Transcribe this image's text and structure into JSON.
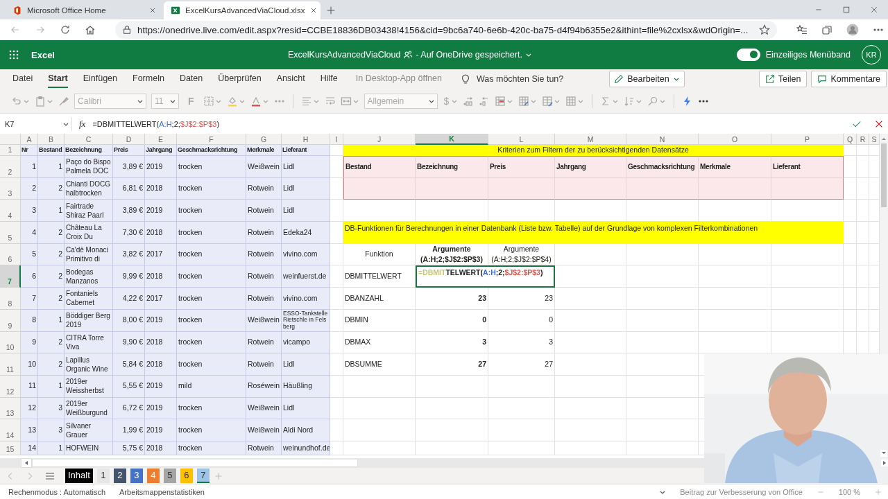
{
  "browser": {
    "tabs": [
      {
        "title": "Microsoft Office Home",
        "selected": false
      },
      {
        "title": "ExcelKursAdvancedViaCloud.xlsx",
        "selected": true
      }
    ],
    "url": "https://onedrive.live.com/edit.aspx?resid=CCBE18836DB03438!4156&cid=9bc6a740-6e6b-420c-ba75-d4f94b6355e2&ithint=file%2cxlsx&wdOrigin=..."
  },
  "app": {
    "name": "Excel",
    "document": "ExcelKursAdvancedViaCloud",
    "save_status": "- Auf OneDrive gespeichert.",
    "single_line_ribbon": {
      "label": "Einzeiliges Menüband",
      "on": true
    },
    "avatar": "KR"
  },
  "ribbon": {
    "tabs": [
      {
        "label": "Datei",
        "selected": false
      },
      {
        "label": "Start",
        "selected": true
      },
      {
        "label": "Einfügen",
        "selected": false
      },
      {
        "label": "Formeln",
        "selected": false
      },
      {
        "label": "Daten",
        "selected": false
      },
      {
        "label": "Überprüfen",
        "selected": false
      },
      {
        "label": "Ansicht",
        "selected": false
      },
      {
        "label": "Hilfe",
        "selected": false
      }
    ],
    "open_in_desktop": "In Desktop-App öffnen",
    "tell_me": "Was möchten Sie tun?",
    "edit_mode": "Bearbeiten",
    "share": "Teilen",
    "comments": "Kommentare",
    "font": "Calibri",
    "font_size": "11",
    "bold_key": "F",
    "number_format": "Allgemein",
    "currency_symbol": "$"
  },
  "formula_bar": {
    "name_box": "K7",
    "fx": "fx",
    "formula": [
      {
        "text": "=DBMITTELWERT("
      },
      {
        "text": "A:H",
        "color": "#3b6cc9"
      },
      {
        "text": ";2;"
      },
      {
        "text": "$J$2:$P$3",
        "color": "#d9534f"
      },
      {
        "text": ")"
      }
    ]
  },
  "sheet": {
    "columns": [
      {
        "label": "A",
        "selected": false
      },
      {
        "label": "B",
        "selected": false
      },
      {
        "label": "C",
        "selected": false
      },
      {
        "label": "D",
        "selected": false
      },
      {
        "label": "E",
        "selected": false
      },
      {
        "label": "F",
        "selected": false
      },
      {
        "label": "G",
        "selected": false
      },
      {
        "label": "H",
        "selected": false
      },
      {
        "label": "I",
        "selected": false
      },
      {
        "label": "J",
        "selected": false
      },
      {
        "label": "K",
        "selected": true
      },
      {
        "label": "L",
        "selected": false
      },
      {
        "label": "M",
        "selected": false
      },
      {
        "label": "N",
        "selected": false
      },
      {
        "label": "O",
        "selected": false
      },
      {
        "label": "P",
        "selected": false
      },
      {
        "label": "Q",
        "selected": false
      },
      {
        "label": "R",
        "selected": false
      },
      {
        "label": "S",
        "selected": false
      }
    ],
    "rows": [
      {
        "label": "1",
        "selected": false
      },
      {
        "label": "2",
        "selected": false
      },
      {
        "label": "3",
        "selected": false
      },
      {
        "label": "4",
        "selected": false
      },
      {
        "label": "5",
        "selected": false
      },
      {
        "label": "6",
        "selected": false
      },
      {
        "label": "7",
        "selected": true
      },
      {
        "label": "8",
        "selected": false
      },
      {
        "label": "9",
        "selected": false
      },
      {
        "label": "10",
        "selected": false
      },
      {
        "label": "11",
        "selected": false
      },
      {
        "label": "12",
        "selected": false
      },
      {
        "label": "13",
        "selected": false
      },
      {
        "label": "14",
        "selected": false
      },
      {
        "label": "15",
        "selected": false
      }
    ],
    "table": {
      "header": [
        "Nr",
        "Bestand",
        "Bezeichnung",
        "Preis",
        "Jahrgang",
        "Geschmacksrichtung",
        "Merkmale",
        "Lieferant"
      ],
      "rows": [
        [
          "1",
          "1",
          "Paço do Bispo Palmela DOC",
          "3,89 €",
          "2019",
          "trocken",
          "Weißwein",
          "Lidl"
        ],
        [
          "2",
          "2",
          "Chianti DOCG halbtrocken",
          "6,81 €",
          "2018",
          "trocken",
          "Rotwein",
          "Lidl"
        ],
        [
          "3",
          "1",
          "Fairtrade Shiraz Paarl",
          "3,89 €",
          "2019",
          "trocken",
          "Rotwein",
          "Lidl"
        ],
        [
          "4",
          "2",
          "Château La Croix Du",
          "7,30 €",
          "2018",
          "trocken",
          "Rotwein",
          "Edeka24"
        ],
        [
          "5",
          "2",
          "Ca'dè Monaci Primitivo di",
          "3,82 €",
          "2017",
          "trocken",
          "Rotwein",
          "vivino.com"
        ],
        [
          "6",
          "2",
          "Bodegas Manzanos",
          "9,99 €",
          "2018",
          "trocken",
          "Rotwein",
          "weinfuerst.de"
        ],
        [
          "7",
          "2",
          "Fontaniels Cabernet",
          "4,22 €",
          "2017",
          "trocken",
          "Rotwein",
          "vivino.com"
        ],
        [
          "8",
          "1",
          "Böddiger Berg 2019",
          "8,00 €",
          "2019",
          "trocken",
          "Weißwein",
          "ESSO-Tankstelle Rietschle in Felsberg"
        ],
        [
          "9",
          "2",
          "CITRA Torre Viva",
          "9,90 €",
          "2018",
          "trocken",
          "Rotwein",
          "vicampo"
        ],
        [
          "10",
          "2",
          "Lapillus Organic Wine",
          "5,84 €",
          "2018",
          "trocken",
          "Rotwein",
          "Lidl"
        ],
        [
          "11",
          "1",
          "2019er Weissherbst",
          "5,55 €",
          "2019",
          "mild",
          "Roséwein",
          "Häußling"
        ],
        [
          "12",
          "3",
          "2019er Weißburgund",
          "6,72 €",
          "2019",
          "trocken",
          "Weißwein",
          "Lidl"
        ],
        [
          "13",
          "3",
          "Silvaner Grauer",
          "1,99 €",
          "2019",
          "trocken",
          "Weißwein",
          "Aldi Nord"
        ],
        [
          "14",
          "1",
          "HOFWEIN",
          "5,75 €",
          "2018",
          "trocken",
          "Rotwein",
          "weinundhof.de"
        ]
      ]
    },
    "criteria": {
      "title": "Kriterien zum Filtern der zu berücksichtigenden Datensätze",
      "fields": [
        "Bestand",
        "Bezeichnung",
        "Preis",
        "Jahrgang",
        "Geschmacksrichtung",
        "Merkmale",
        "Lieferant"
      ]
    },
    "db_title": "DB-Funktionen für Berechnungen in einer Datenbank (Liste bzw. Tabelle) auf der Grundlage von komplexen Filterkombinationen",
    "functions": {
      "header": "Funktion",
      "arguments": [
        {
          "label": "Argumente",
          "args": "(A:H;2;$J$2:$P$3)",
          "bold": true
        },
        {
          "label": "Argumente",
          "args": "(A:H;2;$J$2:$P$4)",
          "bold": false
        }
      ],
      "rows": [
        {
          "name": "DBMITTELWERT",
          "editing": true,
          "editor": [
            {
              "text": "=DBMIT",
              "color": "#c8c47a"
            },
            {
              "text": "TELWERT("
            },
            {
              "text": "A:H",
              "color": "#3b6cc9"
            },
            {
              "text": ";2;"
            },
            {
              "text": "$J$2:$P$3",
              "color": "#d9534f"
            },
            {
              "text": ")"
            }
          ]
        },
        {
          "name": "DBANZAHL",
          "editing": false,
          "values": [
            "23",
            "23"
          ]
        },
        {
          "name": "DBMIN",
          "editing": false,
          "values": [
            "0",
            "0"
          ]
        },
        {
          "name": "DBMAX",
          "editing": false,
          "values": [
            "3",
            "3"
          ]
        },
        {
          "name": "DBSUMME",
          "editing": false,
          "values": [
            "27",
            "27"
          ]
        }
      ]
    }
  },
  "sheet_tabs": [
    {
      "label": "Inhalt",
      "color": "#000000",
      "selected": false
    },
    {
      "label": "1",
      "color": "#e7e6e6",
      "selected": false
    },
    {
      "label": "2",
      "color": "#44546a",
      "selected": false
    },
    {
      "label": "3",
      "color": "#4472c4",
      "selected": false
    },
    {
      "label": "4",
      "color": "#ed7d31",
      "selected": false
    },
    {
      "label": "5",
      "color": "#a5a5a5",
      "selected": false
    },
    {
      "label": "6",
      "color": "#ffc000",
      "selected": false
    },
    {
      "label": "7",
      "color": "#9dc3e6",
      "selected": true
    }
  ],
  "status_bar": {
    "calc_mode": "Rechenmodus : Automatisch",
    "stats": "Arbeitsmappenstatistiken",
    "feedback": "Beitrag zur Verbesserung von Office",
    "zoom": "100 %"
  }
}
